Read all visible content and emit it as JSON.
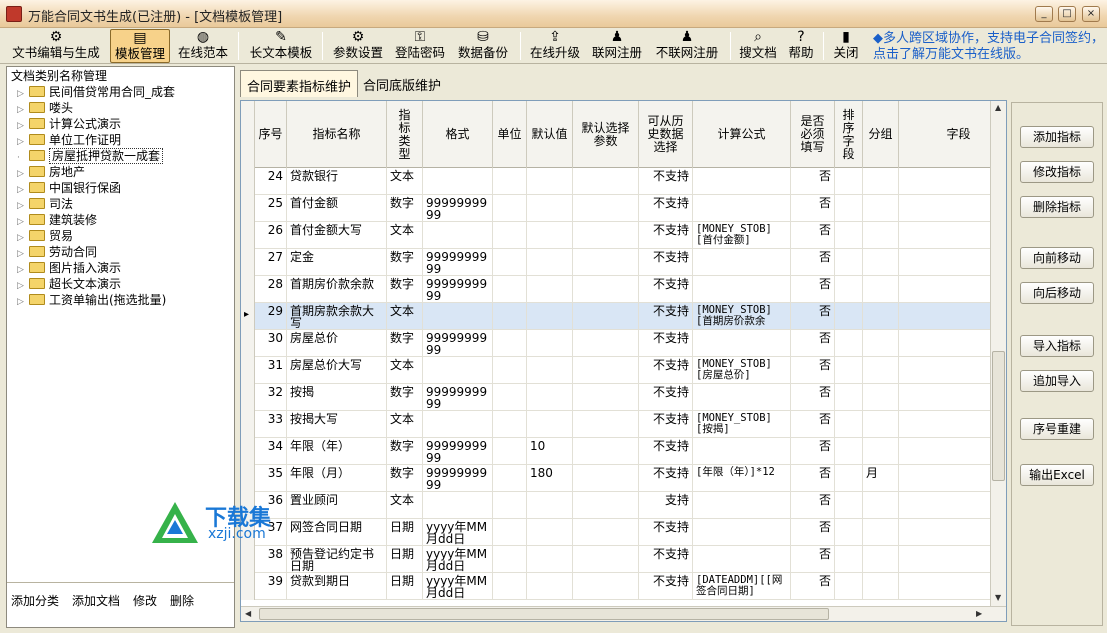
{
  "window": {
    "title": "万能合同文书生成(已注册) - [文档模板管理]",
    "controls": [
      "_",
      "□",
      "×"
    ]
  },
  "toolbar": {
    "buttons": [
      {
        "label": "文书编辑与生成",
        "icon": "gear-icon"
      },
      {
        "label": "模板管理",
        "icon": "template-icon",
        "active": true
      },
      {
        "label": "在线范本",
        "icon": "globe-icon"
      },
      {
        "label": "长文本模板",
        "icon": "pencil-icon"
      },
      {
        "label": "参数设置",
        "icon": "gear-icon"
      },
      {
        "label": "登陆密码",
        "icon": "key-icon"
      },
      {
        "label": "数据备份",
        "icon": "backup-icon"
      },
      {
        "label": "在线升级",
        "icon": "upgrade-icon"
      },
      {
        "label": "联网注册",
        "icon": "person-icon"
      },
      {
        "label": "不联网注册",
        "icon": "person-icon"
      },
      {
        "label": "搜文档",
        "icon": "search-icon"
      },
      {
        "label": "帮助",
        "icon": "help-icon"
      },
      {
        "label": "关闭",
        "icon": "close-icon"
      }
    ],
    "promo": "◆多人跨区域协作，支持电子合同签约，点击了解万能文书在线版。"
  },
  "left_panel": {
    "heading": "文档类别名称管理",
    "tree": [
      {
        "label": "民间借贷常用合同_成套"
      },
      {
        "label": "喽头"
      },
      {
        "label": "计算公式演示"
      },
      {
        "label": "单位工作证明"
      },
      {
        "label": "房屋抵押贷款一成套",
        "selected": true
      },
      {
        "label": "房地产"
      },
      {
        "label": "中国银行保函"
      },
      {
        "label": "司法"
      },
      {
        "label": "建筑装修"
      },
      {
        "label": "贸易"
      },
      {
        "label": "劳动合同"
      },
      {
        "label": "图片插入演示"
      },
      {
        "label": "超长文本演示"
      },
      {
        "label": "工资单输出(拖选批量)"
      }
    ],
    "actions": [
      "添加分类",
      "添加文档",
      "修改",
      "删除"
    ]
  },
  "tabs": [
    {
      "label": "合同要素指标维护",
      "active": true
    },
    {
      "label": "合同底版维护"
    }
  ],
  "grid": {
    "columns": [
      "序号",
      "指标名称",
      "指标类型",
      "格式",
      "单位",
      "默认值",
      "默认选择参数",
      "可从历史数据选择",
      "计算公式",
      "是否必须填写",
      "排序字段",
      "分组",
      "字段"
    ],
    "rows": [
      {
        "no": "24",
        "name": "贷款银行",
        "type": "文本",
        "format": "",
        "unit": "",
        "default": "",
        "param": "",
        "history": "不支持",
        "formula": "",
        "required": "否",
        "group": ""
      },
      {
        "no": "25",
        "name": "首付金额",
        "type": "数字",
        "format": "9999999999",
        "unit": "",
        "default": "",
        "param": "",
        "history": "不支持",
        "formula": "",
        "required": "否",
        "group": ""
      },
      {
        "no": "26",
        "name": "首付金额大写",
        "type": "文本",
        "format": "",
        "unit": "",
        "default": "",
        "param": "",
        "history": "不支持",
        "formula": "[MONEY_STOB][首付金额]",
        "required": "否",
        "group": ""
      },
      {
        "no": "27",
        "name": "定金",
        "type": "数字",
        "format": "9999999999",
        "unit": "",
        "default": "",
        "param": "",
        "history": "不支持",
        "formula": "",
        "required": "否",
        "group": ""
      },
      {
        "no": "28",
        "name": "首期房价款余款",
        "type": "数字",
        "format": "9999999999",
        "unit": "",
        "default": "",
        "param": "",
        "history": "不支持",
        "formula": "",
        "required": "否",
        "group": ""
      },
      {
        "no": "29",
        "name": "首期房款余款大写",
        "type": "文本",
        "format": "",
        "unit": "",
        "default": "",
        "param": "",
        "history": "不支持",
        "formula": "[MONEY_STOB][首期房价款余",
        "required": "否",
        "group": "",
        "selected": true
      },
      {
        "no": "30",
        "name": "房屋总价",
        "type": "数字",
        "format": "9999999999",
        "unit": "",
        "default": "",
        "param": "",
        "history": "不支持",
        "formula": "",
        "required": "否",
        "group": ""
      },
      {
        "no": "31",
        "name": "房屋总价大写",
        "type": "文本",
        "format": "",
        "unit": "",
        "default": "",
        "param": "",
        "history": "不支持",
        "formula": "[MONEY_STOB][房屋总价]",
        "required": "否",
        "group": ""
      },
      {
        "no": "32",
        "name": "按揭",
        "type": "数字",
        "format": "9999999999",
        "unit": "",
        "default": "",
        "param": "",
        "history": "不支持",
        "formula": "",
        "required": "否",
        "group": ""
      },
      {
        "no": "33",
        "name": "按揭大写",
        "type": "文本",
        "format": "",
        "unit": "",
        "default": "",
        "param": "",
        "history": "不支持",
        "formula": "[MONEY_STOB][按揭]",
        "required": "否",
        "group": ""
      },
      {
        "no": "34",
        "name": "年限（年）",
        "type": "数字",
        "format": "9999999999",
        "unit": "",
        "default": "10",
        "param": "",
        "history": "不支持",
        "formula": "",
        "required": "否",
        "group": ""
      },
      {
        "no": "35",
        "name": "年限（月）",
        "type": "数字",
        "format": "9999999999",
        "unit": "",
        "default": "180",
        "param": "",
        "history": "不支持",
        "formula": "[年限（年）]*12",
        "required": "否",
        "group": "月"
      },
      {
        "no": "36",
        "name": "置业顾问",
        "type": "文本",
        "format": "",
        "unit": "",
        "default": "",
        "param": "",
        "history": "支持",
        "formula": "",
        "required": "否",
        "group": ""
      },
      {
        "no": "37",
        "name": "网签合同日期",
        "type": "日期",
        "format": "yyyy年MM月dd日",
        "unit": "",
        "default": "",
        "param": "",
        "history": "不支持",
        "formula": "",
        "required": "否",
        "group": ""
      },
      {
        "no": "38",
        "name": "预告登记约定书日期",
        "type": "日期",
        "format": "yyyy年MM月dd日",
        "unit": "",
        "default": "",
        "param": "",
        "history": "不支持",
        "formula": "",
        "required": "否",
        "group": ""
      },
      {
        "no": "39",
        "name": "贷款到期日",
        "type": "日期",
        "format": "yyyy年MM月dd日",
        "unit": "",
        "default": "",
        "param": "",
        "history": "不支持",
        "formula": "[DATEADDM][[网签合同日期]",
        "required": "否",
        "group": ""
      }
    ]
  },
  "right_panel": {
    "buttons": [
      "添加指标",
      "修改指标",
      "删除指标",
      "向前移动",
      "向后移动",
      "导入指标",
      "追加导入",
      "序号重建",
      "输出Excel"
    ]
  },
  "watermark": {
    "title": "下载集",
    "url": "xzji.com"
  }
}
